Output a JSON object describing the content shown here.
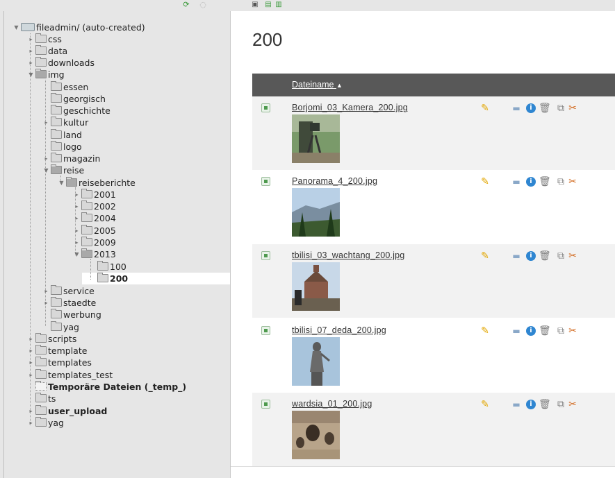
{
  "topbar": {
    "left_icons": [
      "refresh-icon",
      "info-icon"
    ],
    "right_icons": [
      "new-file-icon",
      "upload-icon",
      "new-folder-icon"
    ]
  },
  "tree": {
    "root": "fileadmin/ (auto-created)",
    "items": {
      "css": "css",
      "data": "data",
      "downloads": "downloads",
      "img": "img",
      "essen": "essen",
      "georgisch": "georgisch",
      "geschichte": "geschichte",
      "kultur": "kultur",
      "land": "land",
      "logo": "logo",
      "magazin": "magazin",
      "reise": "reise",
      "reiseberichte": "reiseberichte",
      "y2001": "2001",
      "y2002": "2002",
      "y2004": "2004",
      "y2005": "2005",
      "y2009": "2009",
      "y2013": "2013",
      "f100": "100",
      "f200": "200",
      "service": "service",
      "staedte": "staedte",
      "werbung": "werbung",
      "yag_inner": "yag",
      "scripts": "scripts",
      "template": "template",
      "templates": "templates",
      "templates_test": "templates_test",
      "temp": "Temporäre Dateien (_temp_)",
      "ts": "ts",
      "user_upload": "user_upload",
      "yag": "yag"
    }
  },
  "main": {
    "title": "200",
    "column_header": "Dateiname",
    "sort_indicator": "▲",
    "files": [
      {
        "name": "Borjomi_03_Kamera_200.jpg"
      },
      {
        "name": "Panorama_4_200.jpg"
      },
      {
        "name": "tbilisi_03_wachtang_200.jpg"
      },
      {
        "name": "tbilisi_07_deda_200.jpg"
      },
      {
        "name": "wardsia_01_200.jpg"
      }
    ],
    "actions": [
      "edit-icon",
      "rename-icon",
      "info-icon",
      "delete-icon",
      "copy-icon",
      "cut-icon"
    ]
  },
  "colors": {
    "sidebar_bg": "#e6e6e6",
    "header_bg": "#585858",
    "row_alt_bg": "#f2f2f2",
    "info_blue": "#2f86d1",
    "pencil_yellow": "#e2a600",
    "cut_orange": "#d2691e"
  }
}
